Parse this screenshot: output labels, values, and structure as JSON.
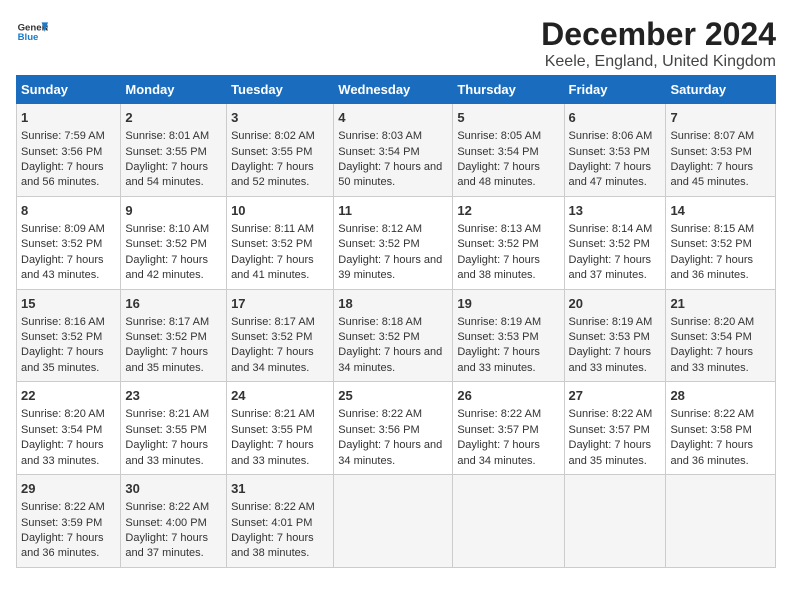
{
  "logo": {
    "line1": "General",
    "line2": "Blue"
  },
  "title": "December 2024",
  "subtitle": "Keele, England, United Kingdom",
  "days_of_week": [
    "Sunday",
    "Monday",
    "Tuesday",
    "Wednesday",
    "Thursday",
    "Friday",
    "Saturday"
  ],
  "weeks": [
    [
      {
        "day": "1",
        "sunrise": "Sunrise: 7:59 AM",
        "sunset": "Sunset: 3:56 PM",
        "daylight": "Daylight: 7 hours and 56 minutes."
      },
      {
        "day": "2",
        "sunrise": "Sunrise: 8:01 AM",
        "sunset": "Sunset: 3:55 PM",
        "daylight": "Daylight: 7 hours and 54 minutes."
      },
      {
        "day": "3",
        "sunrise": "Sunrise: 8:02 AM",
        "sunset": "Sunset: 3:55 PM",
        "daylight": "Daylight: 7 hours and 52 minutes."
      },
      {
        "day": "4",
        "sunrise": "Sunrise: 8:03 AM",
        "sunset": "Sunset: 3:54 PM",
        "daylight": "Daylight: 7 hours and 50 minutes."
      },
      {
        "day": "5",
        "sunrise": "Sunrise: 8:05 AM",
        "sunset": "Sunset: 3:54 PM",
        "daylight": "Daylight: 7 hours and 48 minutes."
      },
      {
        "day": "6",
        "sunrise": "Sunrise: 8:06 AM",
        "sunset": "Sunset: 3:53 PM",
        "daylight": "Daylight: 7 hours and 47 minutes."
      },
      {
        "day": "7",
        "sunrise": "Sunrise: 8:07 AM",
        "sunset": "Sunset: 3:53 PM",
        "daylight": "Daylight: 7 hours and 45 minutes."
      }
    ],
    [
      {
        "day": "8",
        "sunrise": "Sunrise: 8:09 AM",
        "sunset": "Sunset: 3:52 PM",
        "daylight": "Daylight: 7 hours and 43 minutes."
      },
      {
        "day": "9",
        "sunrise": "Sunrise: 8:10 AM",
        "sunset": "Sunset: 3:52 PM",
        "daylight": "Daylight: 7 hours and 42 minutes."
      },
      {
        "day": "10",
        "sunrise": "Sunrise: 8:11 AM",
        "sunset": "Sunset: 3:52 PM",
        "daylight": "Daylight: 7 hours and 41 minutes."
      },
      {
        "day": "11",
        "sunrise": "Sunrise: 8:12 AM",
        "sunset": "Sunset: 3:52 PM",
        "daylight": "Daylight: 7 hours and 39 minutes."
      },
      {
        "day": "12",
        "sunrise": "Sunrise: 8:13 AM",
        "sunset": "Sunset: 3:52 PM",
        "daylight": "Daylight: 7 hours and 38 minutes."
      },
      {
        "day": "13",
        "sunrise": "Sunrise: 8:14 AM",
        "sunset": "Sunset: 3:52 PM",
        "daylight": "Daylight: 7 hours and 37 minutes."
      },
      {
        "day": "14",
        "sunrise": "Sunrise: 8:15 AM",
        "sunset": "Sunset: 3:52 PM",
        "daylight": "Daylight: 7 hours and 36 minutes."
      }
    ],
    [
      {
        "day": "15",
        "sunrise": "Sunrise: 8:16 AM",
        "sunset": "Sunset: 3:52 PM",
        "daylight": "Daylight: 7 hours and 35 minutes."
      },
      {
        "day": "16",
        "sunrise": "Sunrise: 8:17 AM",
        "sunset": "Sunset: 3:52 PM",
        "daylight": "Daylight: 7 hours and 35 minutes."
      },
      {
        "day": "17",
        "sunrise": "Sunrise: 8:17 AM",
        "sunset": "Sunset: 3:52 PM",
        "daylight": "Daylight: 7 hours and 34 minutes."
      },
      {
        "day": "18",
        "sunrise": "Sunrise: 8:18 AM",
        "sunset": "Sunset: 3:52 PM",
        "daylight": "Daylight: 7 hours and 34 minutes."
      },
      {
        "day": "19",
        "sunrise": "Sunrise: 8:19 AM",
        "sunset": "Sunset: 3:53 PM",
        "daylight": "Daylight: 7 hours and 33 minutes."
      },
      {
        "day": "20",
        "sunrise": "Sunrise: 8:19 AM",
        "sunset": "Sunset: 3:53 PM",
        "daylight": "Daylight: 7 hours and 33 minutes."
      },
      {
        "day": "21",
        "sunrise": "Sunrise: 8:20 AM",
        "sunset": "Sunset: 3:54 PM",
        "daylight": "Daylight: 7 hours and 33 minutes."
      }
    ],
    [
      {
        "day": "22",
        "sunrise": "Sunrise: 8:20 AM",
        "sunset": "Sunset: 3:54 PM",
        "daylight": "Daylight: 7 hours and 33 minutes."
      },
      {
        "day": "23",
        "sunrise": "Sunrise: 8:21 AM",
        "sunset": "Sunset: 3:55 PM",
        "daylight": "Daylight: 7 hours and 33 minutes."
      },
      {
        "day": "24",
        "sunrise": "Sunrise: 8:21 AM",
        "sunset": "Sunset: 3:55 PM",
        "daylight": "Daylight: 7 hours and 33 minutes."
      },
      {
        "day": "25",
        "sunrise": "Sunrise: 8:22 AM",
        "sunset": "Sunset: 3:56 PM",
        "daylight": "Daylight: 7 hours and 34 minutes."
      },
      {
        "day": "26",
        "sunrise": "Sunrise: 8:22 AM",
        "sunset": "Sunset: 3:57 PM",
        "daylight": "Daylight: 7 hours and 34 minutes."
      },
      {
        "day": "27",
        "sunrise": "Sunrise: 8:22 AM",
        "sunset": "Sunset: 3:57 PM",
        "daylight": "Daylight: 7 hours and 35 minutes."
      },
      {
        "day": "28",
        "sunrise": "Sunrise: 8:22 AM",
        "sunset": "Sunset: 3:58 PM",
        "daylight": "Daylight: 7 hours and 36 minutes."
      }
    ],
    [
      {
        "day": "29",
        "sunrise": "Sunrise: 8:22 AM",
        "sunset": "Sunset: 3:59 PM",
        "daylight": "Daylight: 7 hours and 36 minutes."
      },
      {
        "day": "30",
        "sunrise": "Sunrise: 8:22 AM",
        "sunset": "Sunset: 4:00 PM",
        "daylight": "Daylight: 7 hours and 37 minutes."
      },
      {
        "day": "31",
        "sunrise": "Sunrise: 8:22 AM",
        "sunset": "Sunset: 4:01 PM",
        "daylight": "Daylight: 7 hours and 38 minutes."
      },
      null,
      null,
      null,
      null
    ]
  ]
}
